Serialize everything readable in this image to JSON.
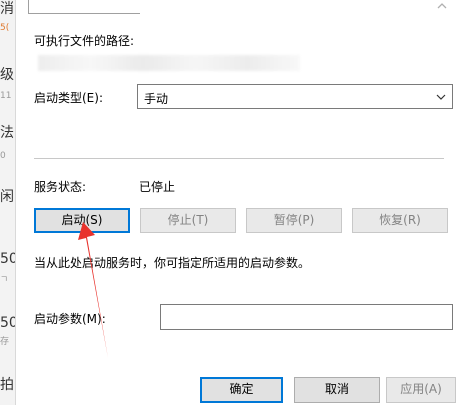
{
  "left_strip": {
    "fragments": [
      "消",
      "5(",
      "级",
      "11",
      "法",
      "0",
      "闲",
      "50",
      "ㄱ",
      "50",
      "存",
      "拍",
      "50"
    ]
  },
  "labels": {
    "exe_path": "可执行文件的路径:",
    "startup_type": "启动类型(E):",
    "service_status": "服务状态:",
    "status_value": "已停止",
    "hint": "当从此处启动服务时，你可指定所适用的启动参数。",
    "params": "启动参数(M):"
  },
  "startup_combo": {
    "value": "手动",
    "icon": "chevron-down-icon"
  },
  "service_buttons": {
    "start": "启动(S)",
    "stop": "停止(T)",
    "pause": "暂停(P)",
    "resume": "恢复(R)"
  },
  "dialog_buttons": {
    "ok": "确定",
    "cancel": "取消",
    "apply": "应用(A)"
  },
  "params_input": {
    "value": ""
  },
  "colors": {
    "annotation_arrow": "#e8322c",
    "focus_border": "#0078d7"
  }
}
